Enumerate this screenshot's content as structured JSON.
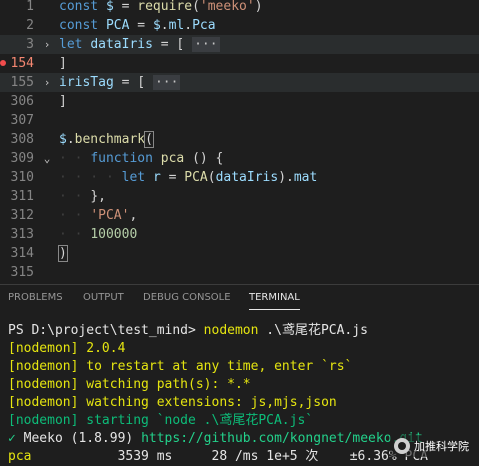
{
  "editor": {
    "lines": [
      {
        "num": "1",
        "fold": "",
        "tokens": [
          [
            "kw",
            "const "
          ],
          [
            "var",
            "$"
          ],
          [
            "punc",
            " = "
          ],
          [
            "fn",
            "require"
          ],
          [
            "punc",
            "("
          ],
          [
            "str",
            "'meeko'"
          ],
          [
            "punc",
            ")"
          ]
        ]
      },
      {
        "num": "2",
        "fold": "",
        "tokens": [
          [
            "kw",
            "const "
          ],
          [
            "var",
            "PCA"
          ],
          [
            "punc",
            " = "
          ],
          [
            "var",
            "$"
          ],
          [
            "punc",
            "."
          ],
          [
            "var",
            "ml"
          ],
          [
            "punc",
            "."
          ],
          [
            "var",
            "Pca"
          ]
        ]
      },
      {
        "num": "3",
        "fold": "›",
        "tokens": [
          [
            "kw",
            "let "
          ],
          [
            "var",
            "dataIris"
          ],
          [
            "punc",
            " = [ "
          ],
          [
            "ell",
            "···"
          ]
        ]
      },
      {
        "num": "154",
        "fold": "",
        "err": true,
        "tokens": [
          [
            "punc",
            "]"
          ]
        ]
      },
      {
        "num": "155",
        "fold": "›",
        "tokens": [
          [
            "var",
            "irisTag"
          ],
          [
            "punc",
            " = [ "
          ],
          [
            "ell",
            "···"
          ]
        ]
      },
      {
        "num": "306",
        "fold": "",
        "tokens": [
          [
            "punc",
            "]"
          ]
        ]
      },
      {
        "num": "307",
        "fold": "",
        "tokens": []
      },
      {
        "num": "308",
        "fold": "",
        "tokens": [
          [
            "var",
            "$"
          ],
          [
            "punc",
            "."
          ],
          [
            "fn",
            "benchmark"
          ],
          [
            "brk",
            "("
          ]
        ]
      },
      {
        "num": "309",
        "fold": "⌄",
        "tokens": [
          [
            "ind",
            "· · "
          ],
          [
            "kw",
            "function "
          ],
          [
            "fn",
            "pca"
          ],
          [
            "punc",
            " () {"
          ]
        ]
      },
      {
        "num": "310",
        "fold": "",
        "tokens": [
          [
            "ind",
            "· · · · "
          ],
          [
            "kw",
            "let "
          ],
          [
            "var",
            "r"
          ],
          [
            "punc",
            " = "
          ],
          [
            "fn",
            "PCA"
          ],
          [
            "punc",
            "("
          ],
          [
            "var",
            "dataIris"
          ],
          [
            "punc",
            ")."
          ],
          [
            "var",
            "mat"
          ]
        ]
      },
      {
        "num": "311",
        "fold": "",
        "tokens": [
          [
            "ind",
            "· · "
          ],
          [
            "punc",
            "},"
          ]
        ]
      },
      {
        "num": "312",
        "fold": "",
        "tokens": [
          [
            "ind",
            "· · "
          ],
          [
            "str",
            "'PCA'"
          ],
          [
            "punc",
            ","
          ]
        ]
      },
      {
        "num": "313",
        "fold": "",
        "tokens": [
          [
            "ind",
            "· · "
          ],
          [
            "num",
            "100000"
          ]
        ]
      },
      {
        "num": "314",
        "fold": "",
        "tokens": [
          [
            "brk",
            ")"
          ]
        ]
      },
      {
        "num": "315",
        "fold": "",
        "tokens": []
      }
    ]
  },
  "panel": {
    "tabs": [
      {
        "label": "PROBLEMS",
        "active": false
      },
      {
        "label": "OUTPUT",
        "active": false
      },
      {
        "label": "DEBUG CONSOLE",
        "active": false
      },
      {
        "label": "TERMINAL",
        "active": true
      }
    ]
  },
  "terminal": {
    "lines": [
      [
        [
          "t-white",
          "PS D:\\project\\test_mind> "
        ],
        [
          "t-yellow",
          "nodemon"
        ],
        [
          "t-white",
          " .\\鸢尾花PCA.js"
        ]
      ],
      [
        [
          "t-yellow",
          "[nodemon] 2.0.4"
        ]
      ],
      [
        [
          "t-yellow",
          "[nodemon] to restart at any time, enter `rs`"
        ]
      ],
      [
        [
          "t-yellow",
          "[nodemon] watching path(s): *.*"
        ]
      ],
      [
        [
          "t-yellow",
          "[nodemon] watching extensions: js,mjs,json"
        ]
      ],
      [
        [
          "t-dgreen",
          "[nodemon] starting `node .\\鸢尾花PCA.js`"
        ]
      ],
      [
        [
          "t-green",
          "✓ "
        ],
        [
          "t-white",
          "Meeko (1.8.99) "
        ],
        [
          "t-green",
          "https://github.com/kongnet/meeko.git"
        ]
      ],
      [
        [
          "t-yellow",
          "pca"
        ],
        [
          "t-white",
          "           3539 ms     28 /ms 1e+5 次    ±6.36% PCA"
        ]
      ]
    ]
  },
  "watermark": {
    "text": "加推科学院"
  }
}
